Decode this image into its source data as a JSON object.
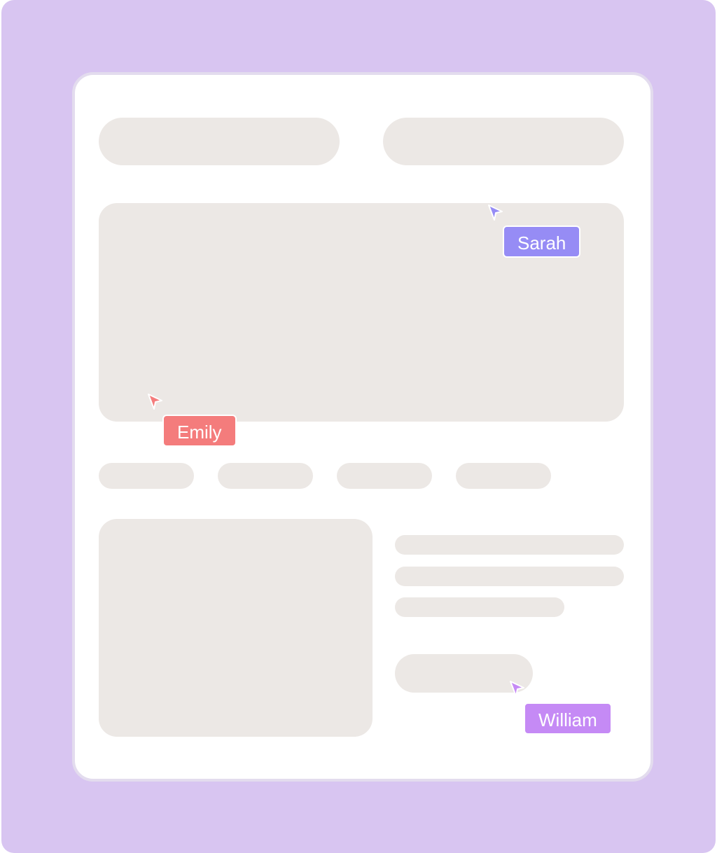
{
  "collaborators": [
    {
      "name": "Sarah",
      "color": "#968cf5"
    },
    {
      "name": "Emily",
      "color": "#f47c7c"
    },
    {
      "name": "William",
      "color": "#c58af5"
    }
  ],
  "palette": {
    "background": "#d8c5f1",
    "canvas": "#ffffff",
    "placeholder": "#ece8e5",
    "canvas_border": "#e3dcee"
  }
}
